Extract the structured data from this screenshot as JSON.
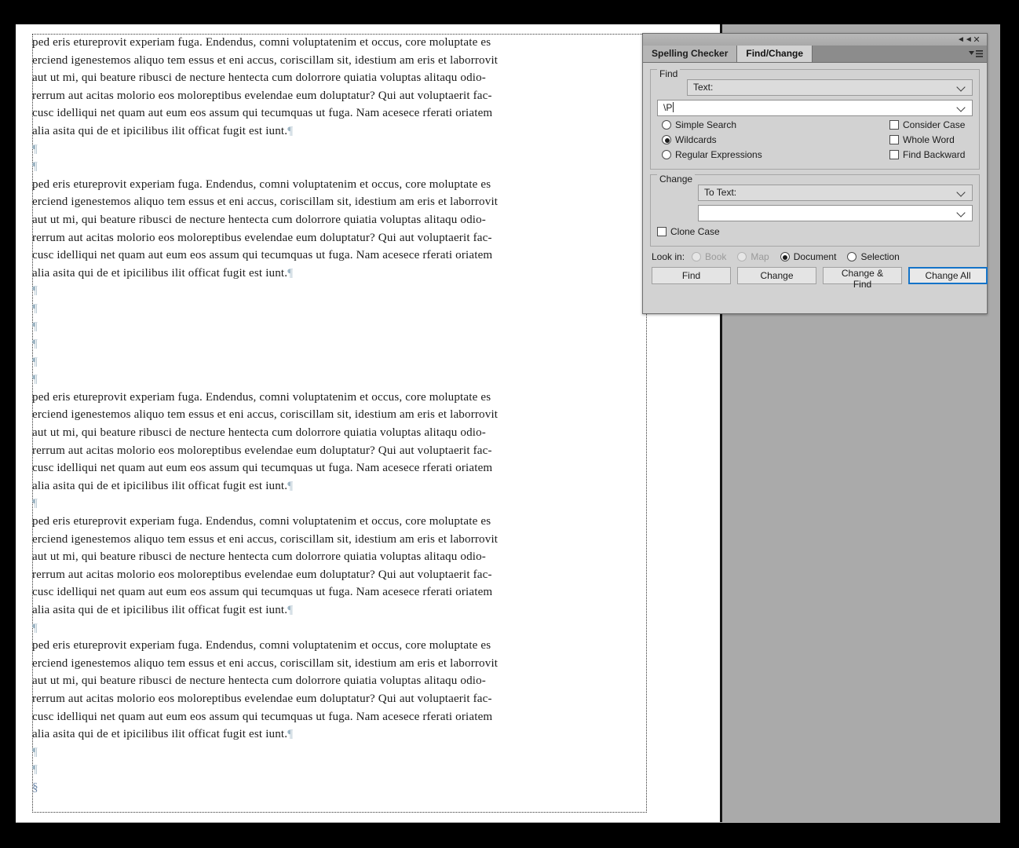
{
  "document": {
    "paragraph_text_lines": [
      "ped eris etureprovit experiam fuga. Endendus, comni voluptatenim et occus, core moluptate es",
      "erciend igenestemos aliquo tem essus et eni accus, coriscillam sit, idestium am eris et laborrovit",
      "aut ut mi, qui beature ribusci de necture hentecta cum dolorrore quiatia voluptas alitaqu odio-",
      "rerrum aut acitas molorio eos moloreptibus evelendae eum doluptatur? Qui aut voluptaerit fac-",
      "cusc idelliqui net quam aut eum eos assum qui tecumquas ut fuga. Nam acesece rferati oriatem",
      "alia asita qui de et ipicilibus ilit officat fugit est iunt."
    ],
    "pilcrow_glyph": "¶",
    "section_glyph": "§",
    "blocks": [
      {
        "type": "paragraph"
      },
      {
        "type": "empty",
        "count": 2
      },
      {
        "type": "paragraph"
      },
      {
        "type": "empty",
        "count": 6
      },
      {
        "type": "paragraph"
      },
      {
        "type": "empty",
        "count": 1
      },
      {
        "type": "paragraph"
      },
      {
        "type": "empty",
        "count": 1
      },
      {
        "type": "paragraph"
      },
      {
        "type": "empty",
        "count": 2
      },
      {
        "type": "section"
      }
    ]
  },
  "panel": {
    "titlebar": {
      "collapse_icon": "collapse-double-chevron-icon",
      "collapse_glyph": "◄◄",
      "close_icon": "close-icon",
      "close_glyph": "✕"
    },
    "tabs": [
      {
        "label": "Spelling Checker",
        "active": false
      },
      {
        "label": "Find/Change",
        "active": true
      }
    ],
    "menu_icon": "panel-menu-icon",
    "find_group": {
      "label": "Find",
      "mode_select": {
        "value": "Text:",
        "caret_icon": "chevron-down-icon"
      },
      "query_input": {
        "value": "\\P",
        "caret_icon": "chevron-down-icon"
      },
      "search_modes": [
        {
          "label": "Simple Search",
          "selected": false,
          "disabled": false
        },
        {
          "label": "Wildcards",
          "selected": true,
          "disabled": false
        },
        {
          "label": "Regular Expressions",
          "selected": false,
          "disabled": false
        }
      ],
      "flags": [
        {
          "label": "Consider Case",
          "checked": false
        },
        {
          "label": "Whole Word",
          "checked": false
        },
        {
          "label": "Find Backward",
          "checked": false
        }
      ]
    },
    "change_group": {
      "label": "Change",
      "mode_select": {
        "value": "To Text:",
        "caret_icon": "chevron-down-icon"
      },
      "replace_input": {
        "value": "",
        "caret_icon": "chevron-down-icon"
      },
      "clone_case": {
        "label": "Clone Case",
        "checked": false
      }
    },
    "look_in": {
      "label": "Look in:",
      "options": [
        {
          "label": "Book",
          "selected": false,
          "disabled": true
        },
        {
          "label": "Map",
          "selected": false,
          "disabled": true
        },
        {
          "label": "Document",
          "selected": true,
          "disabled": false
        },
        {
          "label": "Selection",
          "selected": false,
          "disabled": false
        }
      ]
    },
    "buttons": [
      {
        "label": "Find",
        "focused": false
      },
      {
        "label": "Change",
        "focused": false
      },
      {
        "label": "Change & Find",
        "focused": false
      },
      {
        "label": "Change All",
        "focused": true
      }
    ]
  },
  "colors": {
    "panel_bg": "#d2d2d2",
    "canvas_bg": "#aaaaaa",
    "page_bg": "#ffffff",
    "app_bg": "#000000",
    "focus_blue": "#1473c8",
    "pilcrow": "#9fb6c4"
  }
}
